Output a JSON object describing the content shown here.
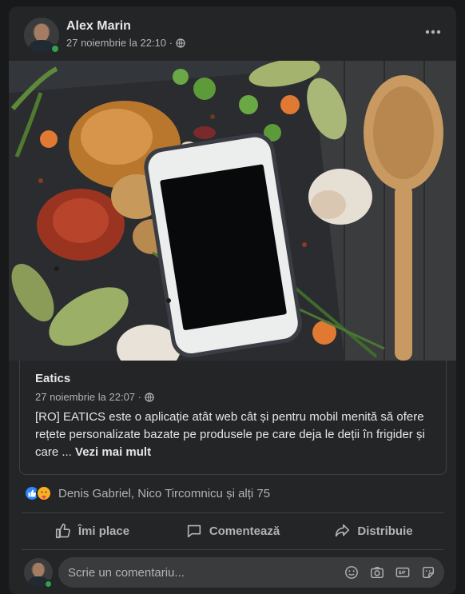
{
  "post": {
    "author": "Alex Marin",
    "timestamp": "27 noiembrie la 22:10 ·",
    "privacy_icon": "globe-icon",
    "more_icon": "more-horizontal-icon",
    "more_label": "•••"
  },
  "shared_link": {
    "title": "Eatics",
    "timestamp": "27 noiembrie la 22:07 ·",
    "text": "[RO] EATICS este o aplicație atât web cât și pentru mobil menită să ofere rețete personalizate bazate pe produsele pe care deja le deții în frigider și care ...",
    "see_more": "Vezi mai mult"
  },
  "reactions": {
    "icons": [
      "like-icon",
      "care-icon"
    ],
    "names": "Denis Gabriel, Nico Tircomnicu și alți 75"
  },
  "actions": {
    "like": "Îmi place",
    "comment": "Comentează",
    "share": "Distribuie"
  },
  "comment_box": {
    "placeholder": "Scrie un comentariu...",
    "tools": [
      "emoji-icon",
      "camera-icon",
      "gif-icon",
      "sticker-icon"
    ]
  },
  "colors": {
    "background": "#18191a",
    "card": "#242526",
    "text_primary": "#e4e6eb",
    "text_secondary": "#b0b3b8",
    "accent_like": "#2d88ff",
    "online": "#31a24c"
  }
}
